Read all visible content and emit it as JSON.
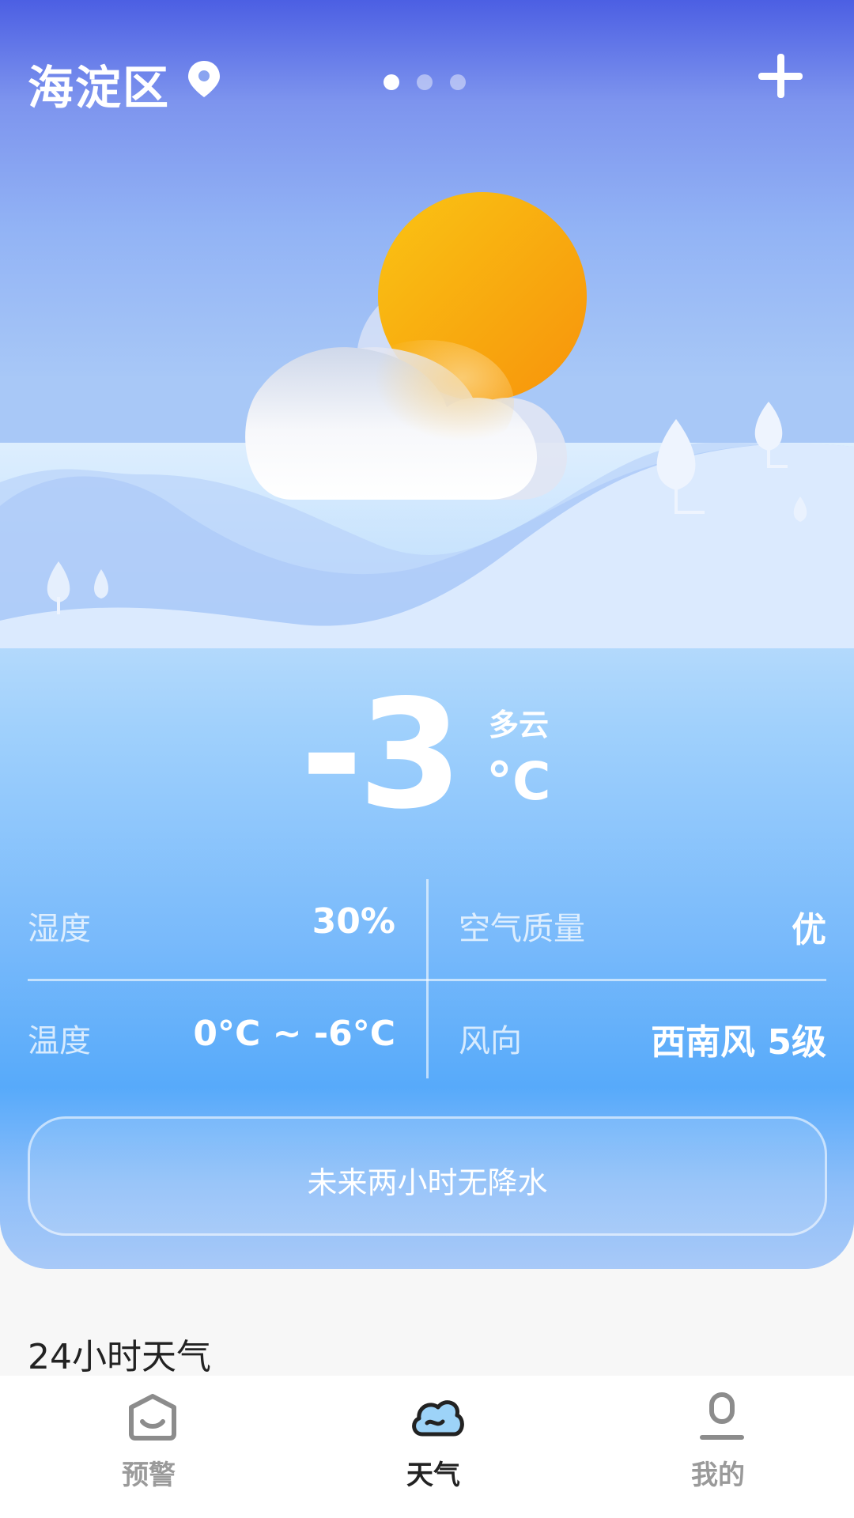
{
  "header": {
    "city": "海淀区",
    "page_dots": 3,
    "active_dot": 1
  },
  "current": {
    "temperature": "-3",
    "condition": "多云",
    "unit": "°C"
  },
  "details": {
    "humidity_label": "湿度",
    "humidity_value": "30%",
    "aqi_label": "空气质量",
    "aqi_value": "优",
    "temp_label": "温度",
    "temp_value": "0°C ~ -6°C",
    "wind_label": "风向",
    "wind_value": "西南风 5级"
  },
  "precip_notice": "未来两小时无降水",
  "section_title": "24小时天气",
  "tabs": [
    {
      "label": "预警",
      "icon": "home-smile-icon",
      "active": false
    },
    {
      "label": "天气",
      "icon": "cloud-icon",
      "active": true
    },
    {
      "label": "我的",
      "icon": "user-icon",
      "active": false
    }
  ],
  "colors": {
    "sun": "#f9a61a",
    "sky_top": "#4c5fe3",
    "card_bottom": "#57aafa"
  }
}
